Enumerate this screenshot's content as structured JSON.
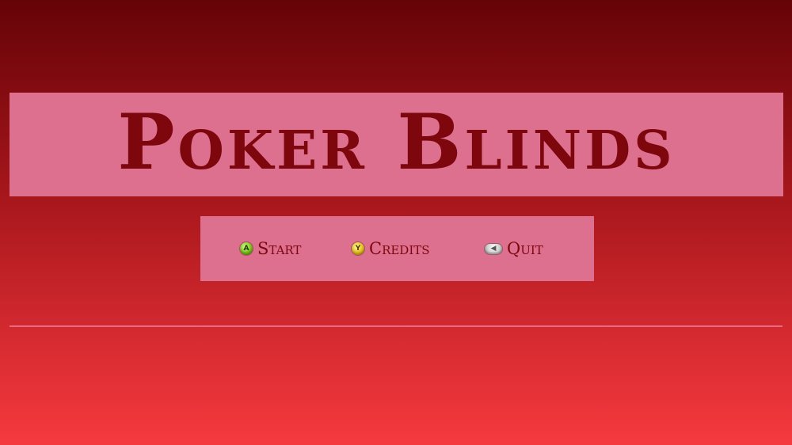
{
  "title": "Poker Blinds",
  "menu": {
    "start": {
      "label": "Start",
      "button": "A",
      "icon": "a-button-icon"
    },
    "credits": {
      "label": "Credits",
      "button": "Y",
      "icon": "y-button-icon"
    },
    "quit": {
      "label": "Quit",
      "button": "◀",
      "icon": "back-button-icon"
    }
  },
  "colors": {
    "background_top": "#650307",
    "background_bottom": "#f53a3e",
    "panel": "#dd6f8f",
    "text": "#7e070d",
    "divider": "#e86a82"
  }
}
